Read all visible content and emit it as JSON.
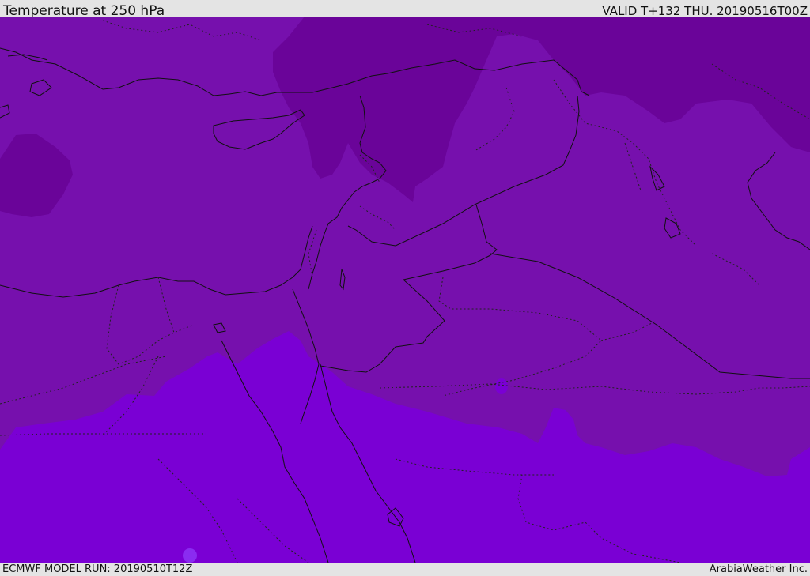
{
  "header": {
    "title": "Temperature at 250 hPa",
    "valid": "VALID T+132 THU. 20190516T00Z"
  },
  "footer": {
    "model_run": "ECMWF MODEL RUN: 20190510T12Z",
    "credit": "ArabiaWeather Inc."
  },
  "colors": {
    "background": "#e4e4e4",
    "band_darkest": "#6a0499",
    "band_mid": "#7610ad",
    "band_light": "#7a00d4",
    "highlight_spot": "#8a2cf0",
    "coastline": "#111111"
  },
  "map": {
    "type": "filled-contour temperature map",
    "borders": "dotted"
  }
}
